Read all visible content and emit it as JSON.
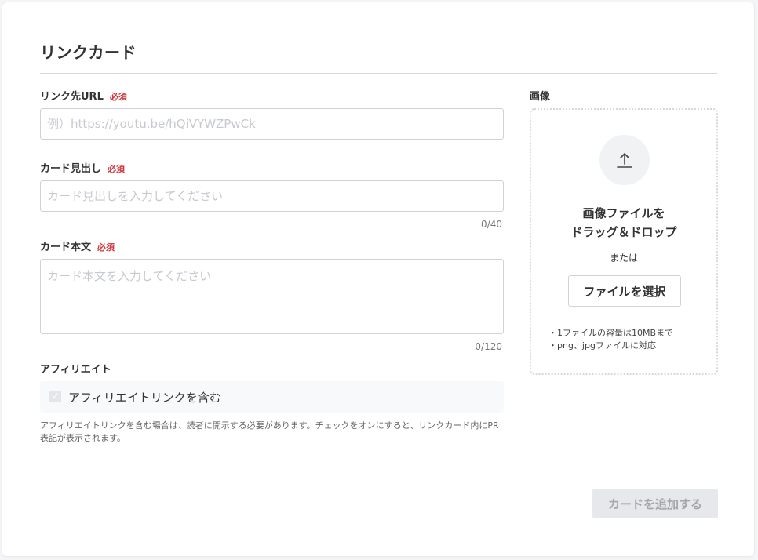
{
  "page": {
    "title": "リンクカード"
  },
  "form": {
    "required_label": "必須",
    "url": {
      "label": "リンク先URL",
      "placeholder": "例）https://youtu.be/hQiVYWZPwCk",
      "value": ""
    },
    "heading": {
      "label": "カード見出し",
      "placeholder": "カード見出しを入力してください",
      "value": "",
      "counter": "0/40"
    },
    "body": {
      "label": "カード本文",
      "placeholder": "カード本文を入力してください",
      "value": "",
      "counter": "0/120"
    },
    "affiliate": {
      "section_label": "アフィリエイト",
      "checkbox_label": "アフィリエイトリンクを含む",
      "checked": false,
      "note": "アフィリエイトリンクを含む場合は、読者に開示する必要があります。チェックをオンにすると、リンクカード内にPR表記が表示されます。"
    }
  },
  "image": {
    "label": "画像",
    "upload_icon": "upload-arrow-icon",
    "drop_line1": "画像ファイルを",
    "drop_line2": "ドラッグ＆ドロップ",
    "or_text": "または",
    "select_button": "ファイルを選択",
    "notes": [
      "1ファイルの容量は10MBまで",
      "png、jpgファイルに対応"
    ]
  },
  "actions": {
    "submit_label": "カードを追加する",
    "submit_disabled": true
  },
  "colors": {
    "required": "#d0343b",
    "border": "#cfd3d9",
    "disabled_bg": "#e6e8eb",
    "disabled_text": "#a3a7ad"
  }
}
